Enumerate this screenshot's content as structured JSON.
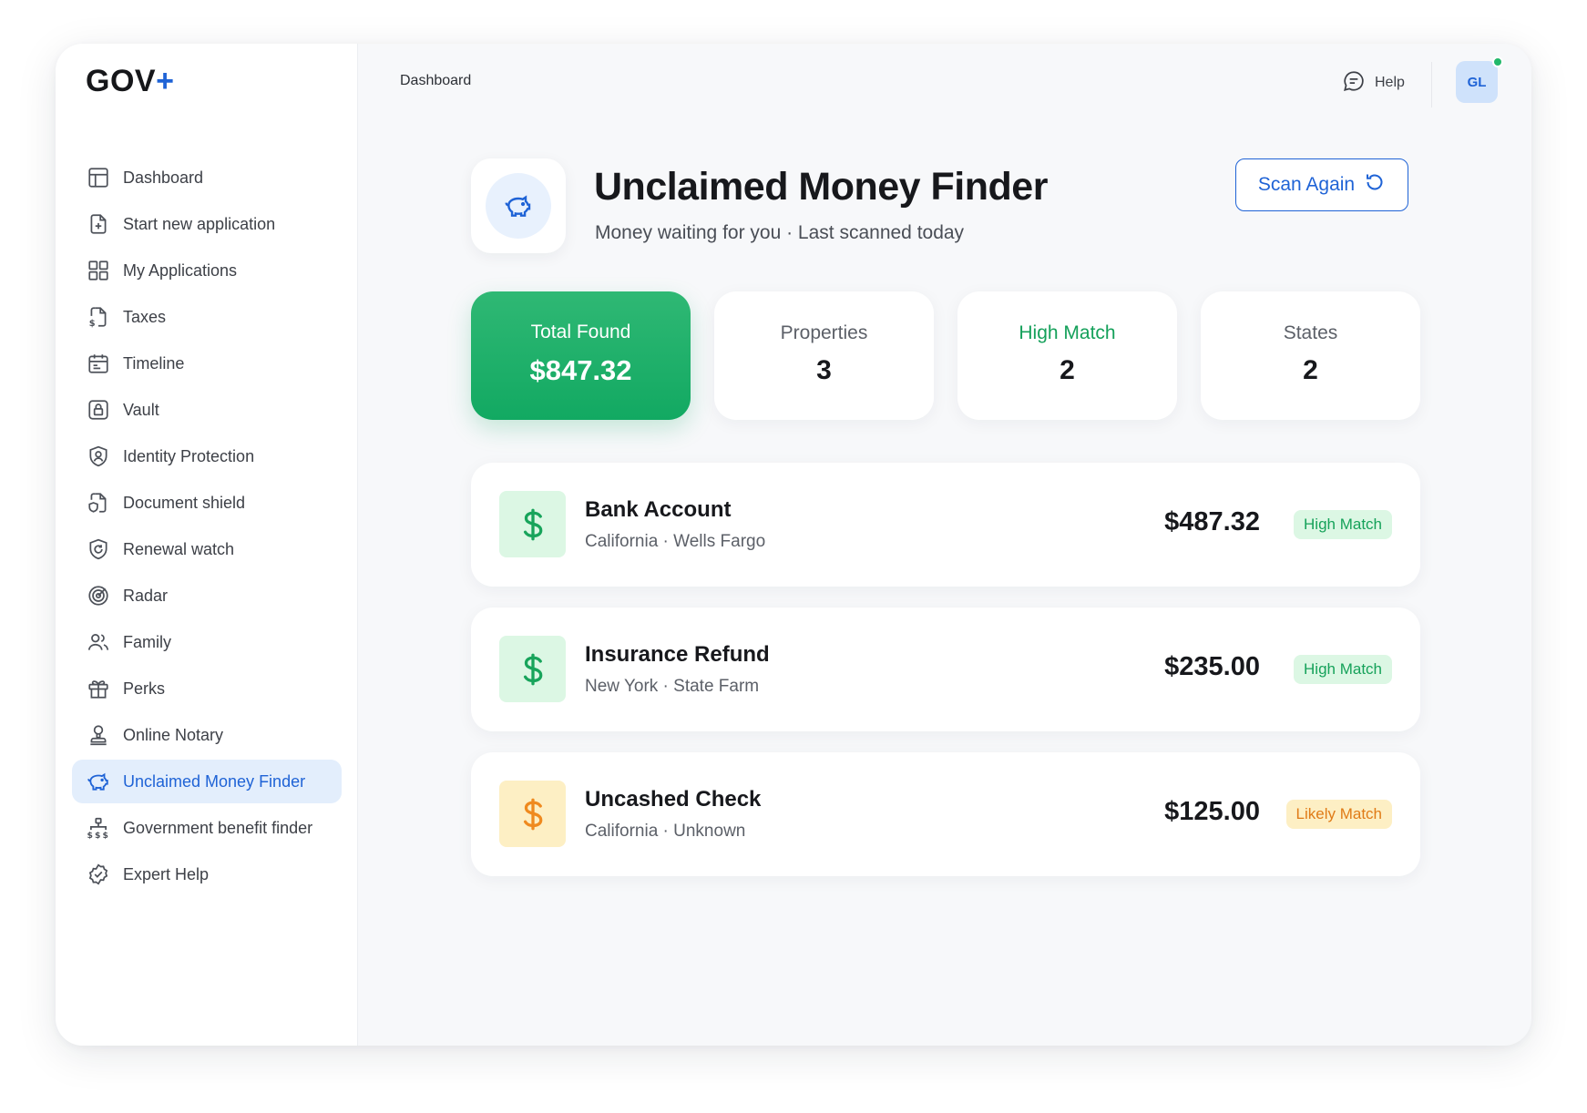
{
  "app": {
    "logo_text": "GOV",
    "logo_plus": "+"
  },
  "sidebar": {
    "items": [
      {
        "label": "Dashboard",
        "icon": "layout-icon"
      },
      {
        "label": "Start new application",
        "icon": "file-plus-icon"
      },
      {
        "label": "My Applications",
        "icon": "grid-icon"
      },
      {
        "label": "Taxes",
        "icon": "tax-document-icon"
      },
      {
        "label": "Timeline",
        "icon": "calendar-icon"
      },
      {
        "label": "Vault",
        "icon": "lock-icon"
      },
      {
        "label": "Identity Protection",
        "icon": "shield-user-icon"
      },
      {
        "label": "Document shield",
        "icon": "document-shield-icon"
      },
      {
        "label": "Renewal watch",
        "icon": "shield-refresh-icon"
      },
      {
        "label": "Radar",
        "icon": "radar-icon"
      },
      {
        "label": "Family",
        "icon": "users-icon"
      },
      {
        "label": "Perks",
        "icon": "gift-icon"
      },
      {
        "label": "Online Notary",
        "icon": "stamp-icon"
      },
      {
        "label": "Unclaimed Money Finder",
        "icon": "piggy-bank-icon",
        "active": true
      },
      {
        "label": "Government benefit finder",
        "icon": "hierarchy-money-icon"
      },
      {
        "label": "Expert Help",
        "icon": "check-badge-icon"
      }
    ]
  },
  "topbar": {
    "breadcrumb": "Dashboard",
    "help_label": "Help",
    "avatar_initials": "GL",
    "online_status_color": "#22b86a"
  },
  "header": {
    "title": "Unclaimed Money Finder",
    "subtitle": "Money waiting for you · Last scanned today",
    "scan_button_label": "Scan Again"
  },
  "stats": [
    {
      "label": "Total Found",
      "value": "$847.32"
    },
    {
      "label": "Properties",
      "value": "3"
    },
    {
      "label": "High Match",
      "value": "2"
    },
    {
      "label": "States",
      "value": "2"
    }
  ],
  "results": [
    {
      "title": "Bank Account",
      "meta": "California · Wells Fargo",
      "amount": "$487.32",
      "match": "High Match"
    },
    {
      "title": "Insurance Refund",
      "meta": "New York · State Farm",
      "amount": "$235.00",
      "match": "High Match"
    },
    {
      "title": "Uncashed Check",
      "meta": "California · Unknown",
      "amount": "$125.00",
      "match": "Likely Match"
    }
  ],
  "colors": {
    "accent": "#1f63d6",
    "success": "#12a962",
    "warning": "#ef8a1f"
  }
}
